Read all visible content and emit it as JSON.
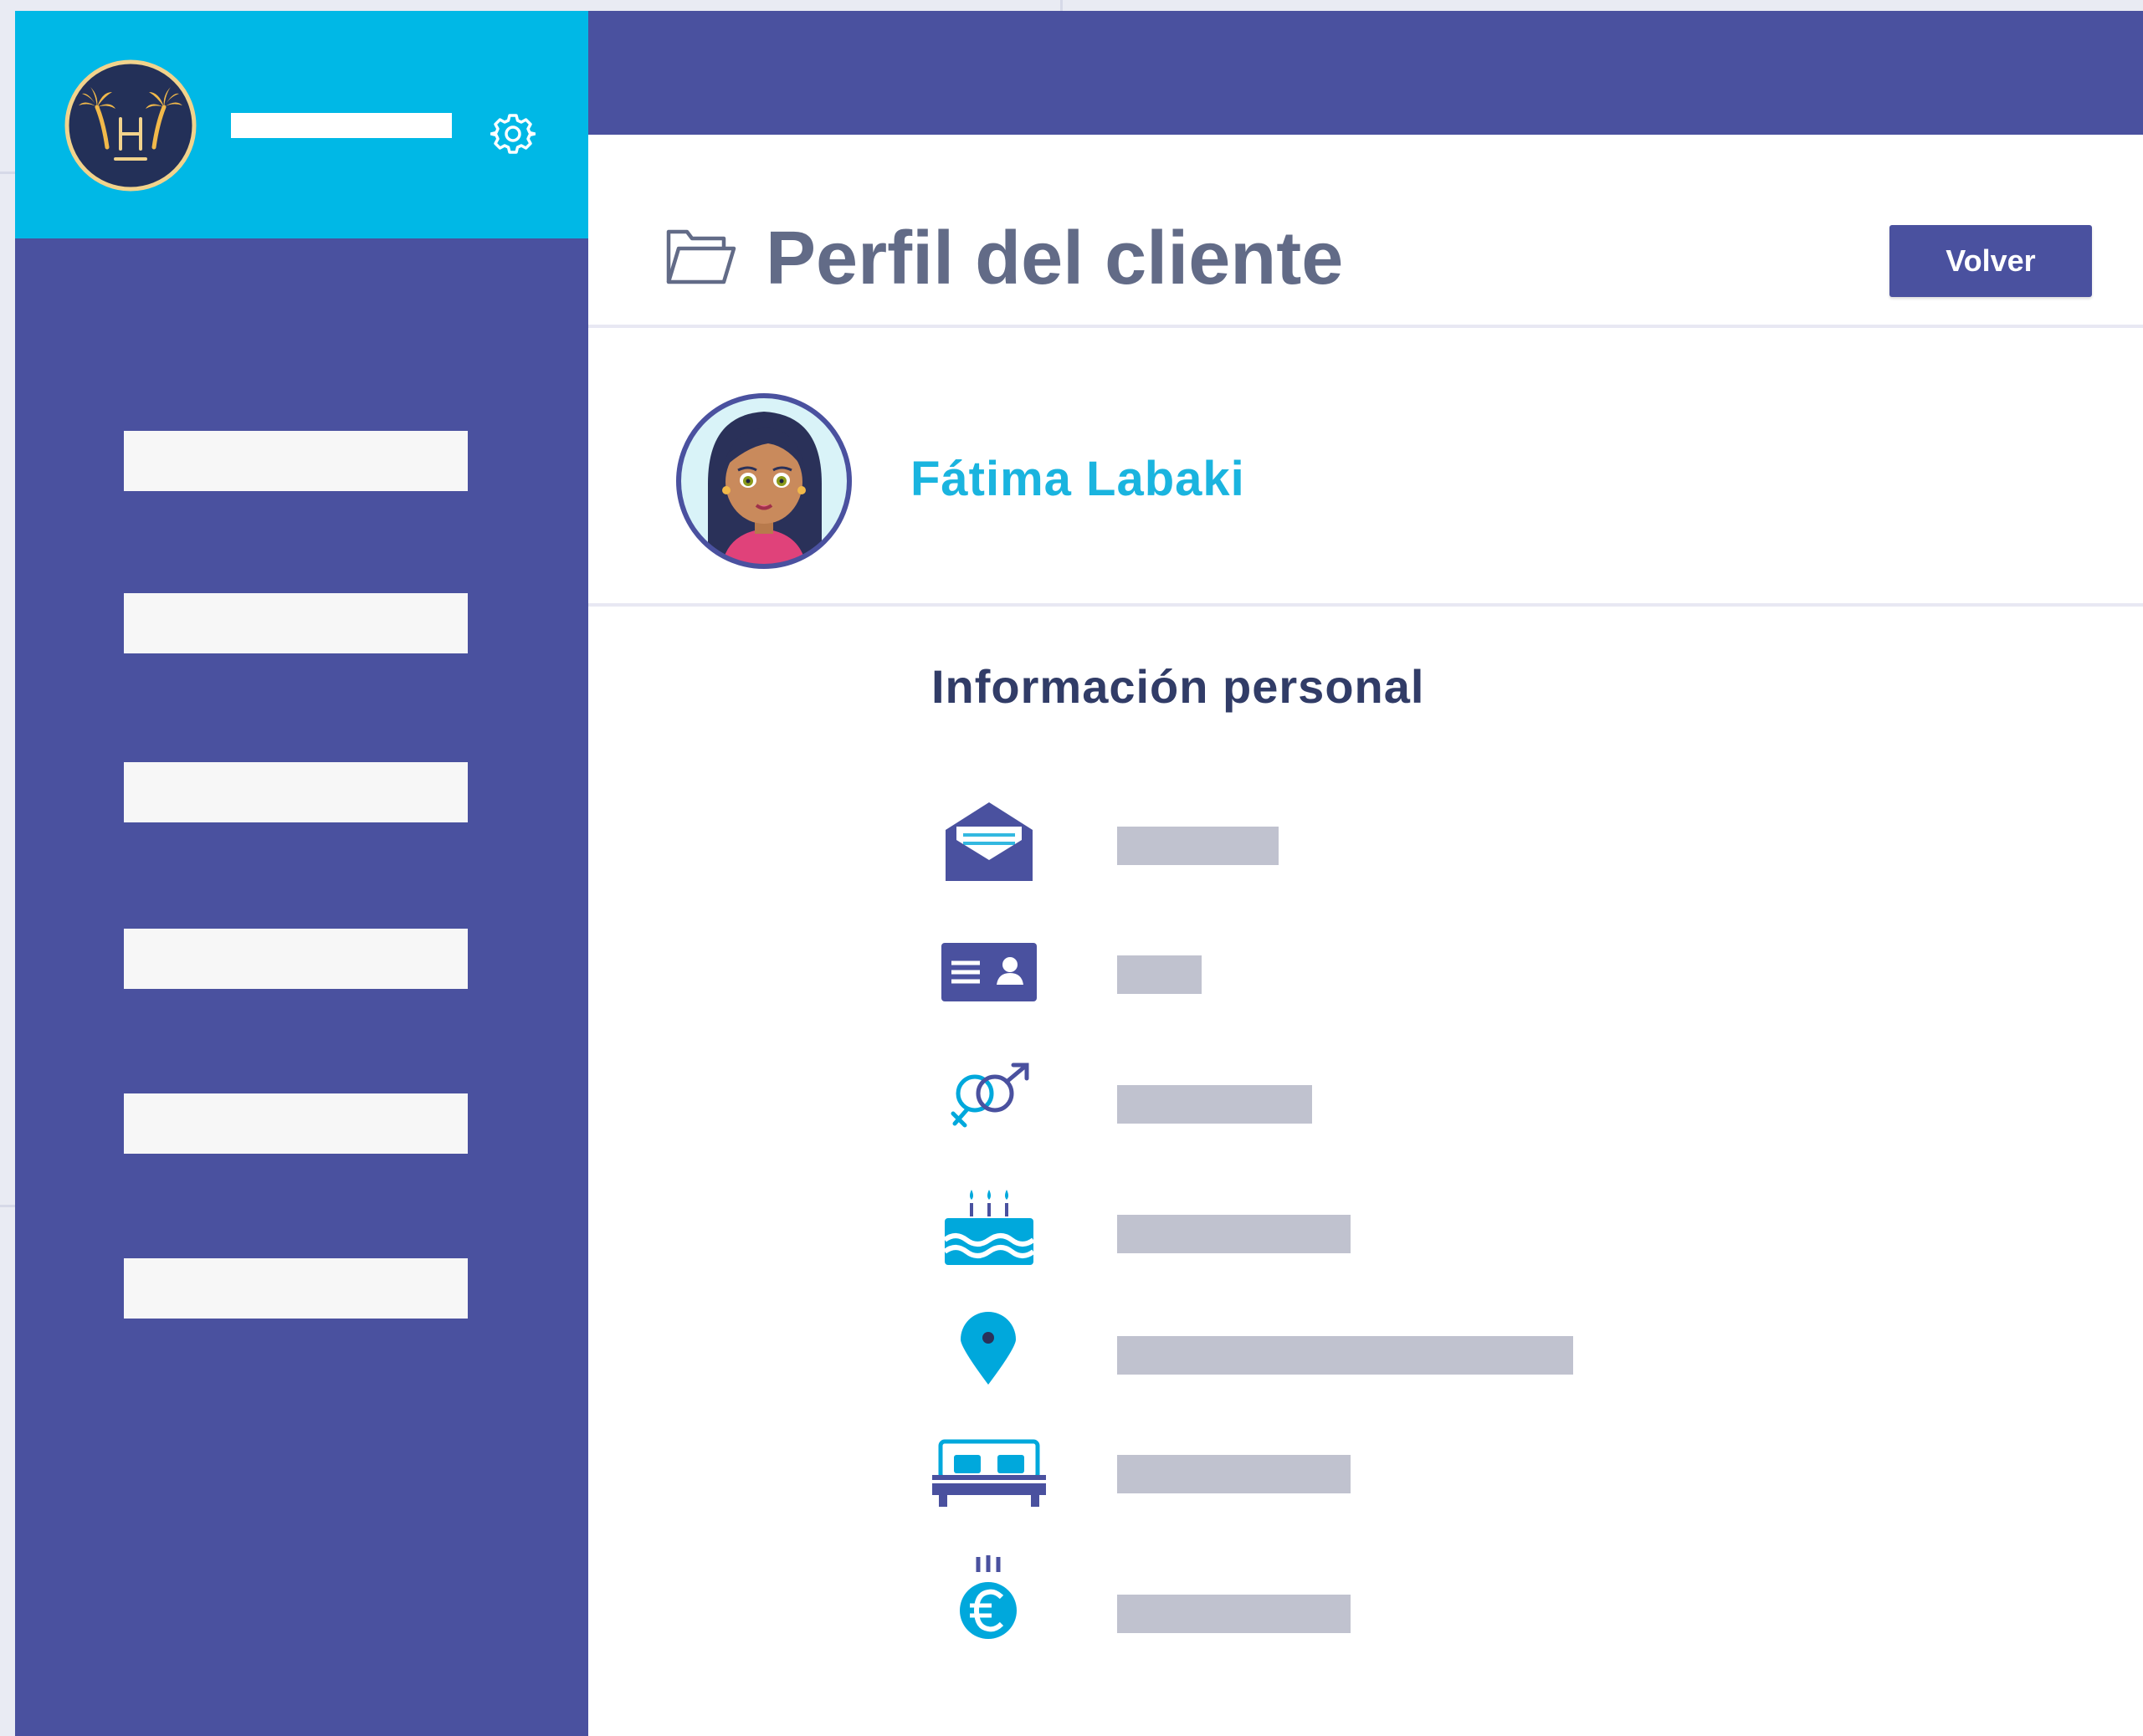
{
  "header": {
    "title": "Perfil del cliente",
    "back_button_label": "Volver"
  },
  "client": {
    "name": "Fátima Labaki"
  },
  "personal_info": {
    "title": "Información personal",
    "rows": [
      {
        "icon": "envelope-icon"
      },
      {
        "icon": "id-card-icon"
      },
      {
        "icon": "gender-icon"
      },
      {
        "icon": "birthday-cake-icon"
      },
      {
        "icon": "location-pin-icon"
      },
      {
        "icon": "bed-icon"
      },
      {
        "icon": "euro-coin-icon"
      }
    ]
  },
  "sidebar": {
    "icons": [
      "hotel-logo-icon",
      "gear-icon"
    ]
  },
  "colors": {
    "primary": "#4a519f",
    "accent": "#00b8e6",
    "title": "#626b87",
    "client_name": "#1ab4df",
    "section_title": "#313c67",
    "placeholder": "#c0c2cf",
    "nav_item": "#f7f7f7"
  }
}
